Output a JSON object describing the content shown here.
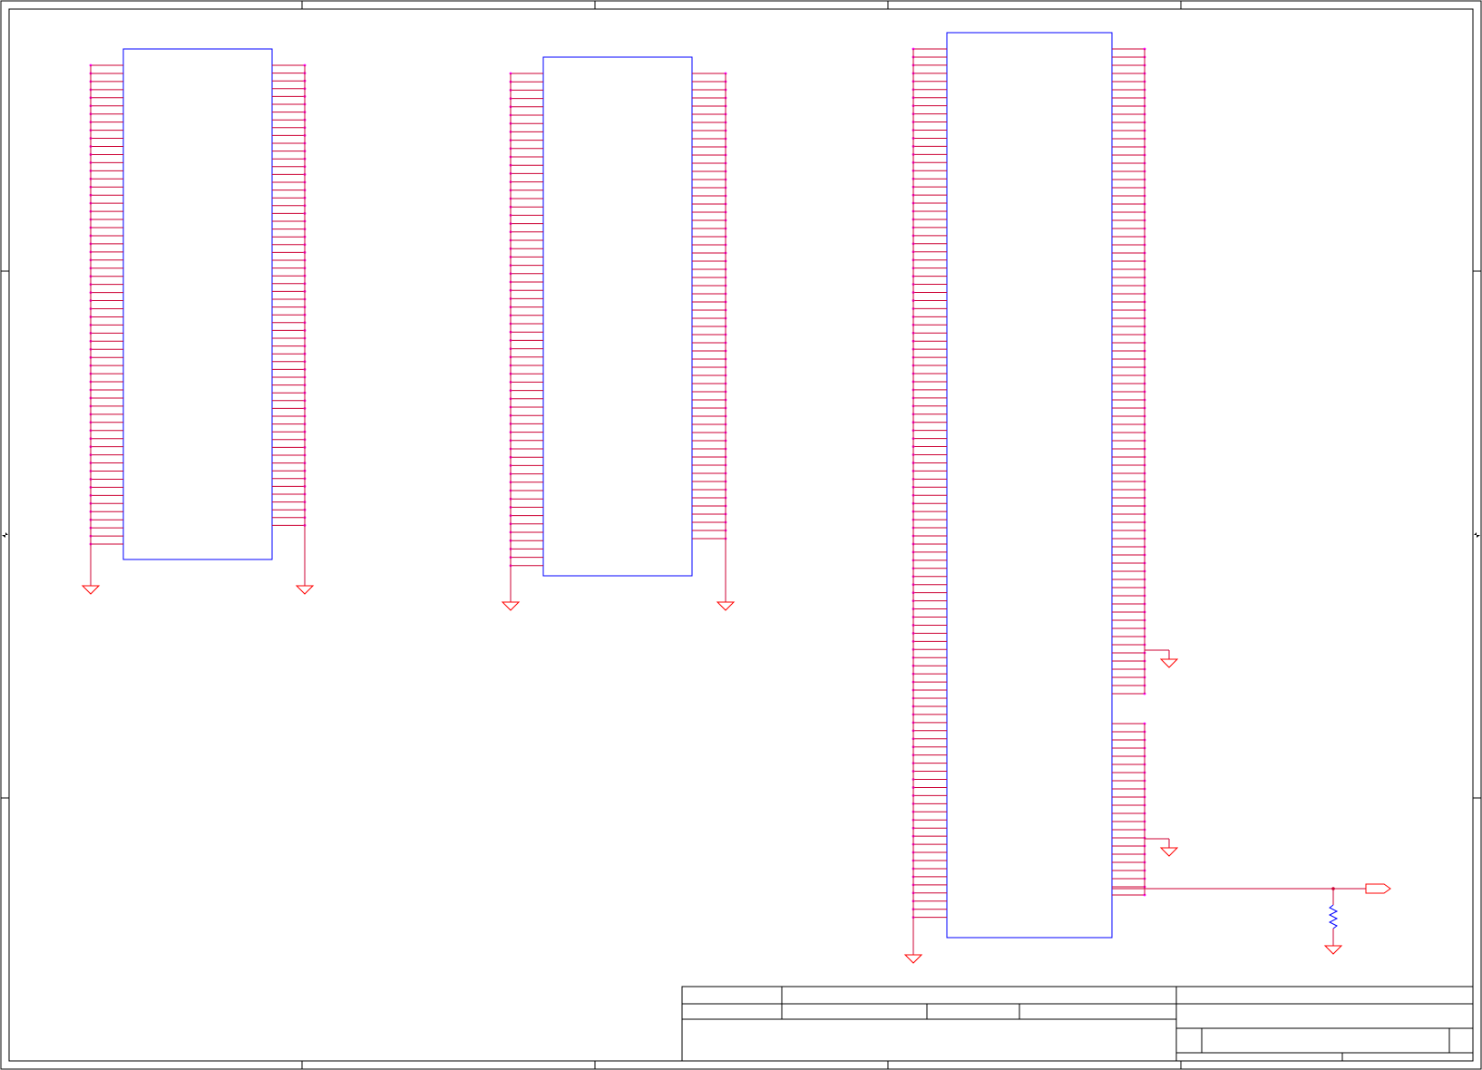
{
  "sheet": {
    "colors": {
      "frame": "#000000",
      "component_outline": "#0000ff",
      "wire": "#cc0033",
      "pin_dot": "#ff00ff",
      "ground": "#ff0000",
      "resistor": "#0000ff"
    }
  },
  "components": [
    {
      "name": "connector-left",
      "left_pins": 60,
      "right_pins": 60,
      "ground_symbols": 2
    },
    {
      "name": "connector-middle",
      "left_pins": 60,
      "right_pins": 58,
      "ground_symbols": 2
    },
    {
      "name": "connector-right",
      "left_pins": 108,
      "right_pins": 102,
      "ground_symbols": 3
    }
  ],
  "extras": {
    "output_port": "off-page-connector",
    "pulldown": "resistor-to-ground"
  },
  "title_block": {
    "fields": []
  }
}
